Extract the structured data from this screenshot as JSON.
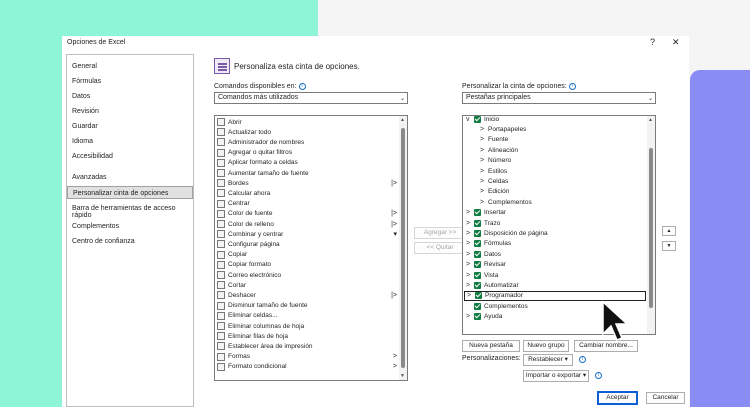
{
  "window": {
    "title": "Opciones de Excel",
    "help": "?",
    "close": "✕"
  },
  "nav": {
    "items": [
      "General",
      "Fórmulas",
      "Datos",
      "Revisión",
      "Guardar",
      "Idioma",
      "Accesibilidad",
      "Avanzadas",
      "Personalizar cinta de opciones",
      "Barra de herramientas de acceso rápido",
      "Complementos",
      "Centro de confianza"
    ],
    "selected": "Personalizar cinta de opciones"
  },
  "header": {
    "text": "Personaliza esta cinta de opciones."
  },
  "left": {
    "label": "Comandos disponibles en:",
    "select_value": "Comandos más utilizados",
    "commands": [
      {
        "label": "Abrir"
      },
      {
        "label": "Actualizar todo"
      },
      {
        "label": "Administrador de nombres"
      },
      {
        "label": "Agregar o quitar filtros"
      },
      {
        "label": "Aplicar formato a celdas"
      },
      {
        "label": "Aumentar tamaño de fuente"
      },
      {
        "label": "Bordes",
        "sub": "|>"
      },
      {
        "label": "Calcular ahora"
      },
      {
        "label": "Centrar"
      },
      {
        "label": "Color de fuente",
        "sub": "|>"
      },
      {
        "label": "Color de relleno",
        "sub": "|>"
      },
      {
        "label": "Combinar y centrar",
        "sub": "▾"
      },
      {
        "label": "Configurar página"
      },
      {
        "label": "Copiar"
      },
      {
        "label": "Copiar formato"
      },
      {
        "label": "Correo electrónico"
      },
      {
        "label": "Cortar"
      },
      {
        "label": "Deshacer",
        "sub": "|>"
      },
      {
        "label": "Disminuir tamaño de fuente"
      },
      {
        "label": "Eliminar celdas..."
      },
      {
        "label": "Eliminar columnas de hoja"
      },
      {
        "label": "Eliminar filas de hoja"
      },
      {
        "label": "Establecer área de impresión"
      },
      {
        "label": "Formas",
        "sub": ">"
      },
      {
        "label": "Formato condicional",
        "sub": ">"
      }
    ]
  },
  "middle": {
    "add": "Agregar >>",
    "remove": "<< Quitar"
  },
  "right": {
    "label": "Personalizar la cinta de opciones:",
    "select_value": "Pestañas principales",
    "tree": [
      {
        "label": "Inicio",
        "level": 0,
        "chev": "v",
        "checked": true
      },
      {
        "label": "Portapapeles",
        "level": 1,
        "chev": ">"
      },
      {
        "label": "Fuente",
        "level": 1,
        "chev": ">"
      },
      {
        "label": "Alineación",
        "level": 1,
        "chev": ">"
      },
      {
        "label": "Número",
        "level": 1,
        "chev": ">"
      },
      {
        "label": "Estilos",
        "level": 1,
        "chev": ">"
      },
      {
        "label": "Celdas",
        "level": 1,
        "chev": ">"
      },
      {
        "label": "Edición",
        "level": 1,
        "chev": ">"
      },
      {
        "label": "Complementos",
        "level": 1,
        "chev": ">"
      },
      {
        "label": "Insertar",
        "level": 0,
        "chev": ">",
        "checked": true
      },
      {
        "label": "Trazo",
        "level": 0,
        "chev": ">",
        "checked": true
      },
      {
        "label": "Disposición de página",
        "level": 0,
        "chev": ">",
        "checked": true
      },
      {
        "label": "Fórmulas",
        "level": 0,
        "chev": ">",
        "checked": true
      },
      {
        "label": "Datos",
        "level": 0,
        "chev": ">",
        "checked": true
      },
      {
        "label": "Revisar",
        "level": 0,
        "chev": ">",
        "checked": true
      },
      {
        "label": "Vista",
        "level": 0,
        "chev": ">",
        "checked": true
      },
      {
        "label": "Automatizar",
        "level": 0,
        "chev": ">",
        "checked": true
      },
      {
        "label": "Programador",
        "level": 0,
        "chev": ">",
        "checked": true,
        "focus": true
      },
      {
        "label": "Complementos",
        "level": 0,
        "chev": "",
        "checked": true
      },
      {
        "label": "Ayuda",
        "level": 0,
        "chev": ">",
        "checked": true
      }
    ],
    "new_tab": "Nueva pestaña",
    "new_group": "Nuevo grupo",
    "rename": "Cambiar nombre...",
    "customizations_label": "Personalizaciones:",
    "reset": "Restablecer ▾",
    "import_export": "Importar o exportar ▾",
    "up": "▲",
    "down": "▼"
  },
  "footer": {
    "ok": "Aceptar",
    "cancel": "Cancelar"
  }
}
